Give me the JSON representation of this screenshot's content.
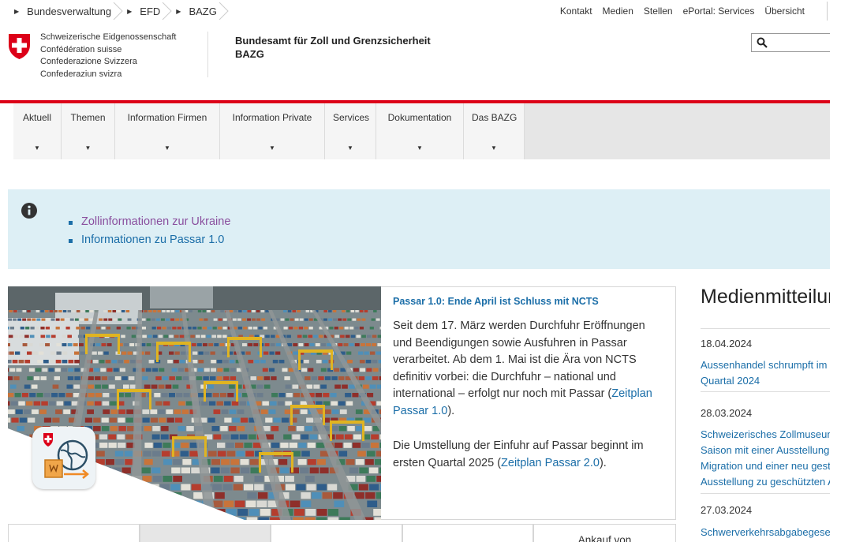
{
  "breadcrumb": [
    "Bundesverwaltung",
    "EFD",
    "BAZG"
  ],
  "toplinks": [
    "Kontakt",
    "Medien",
    "Stellen",
    "ePortal: Services",
    "Übersicht"
  ],
  "confederation": [
    "Schweizerische Eidgenossenschaft",
    "Confédération suisse",
    "Confederazione Svizzera",
    "Confederaziun svizra"
  ],
  "office": {
    "line1": "Bundesamt für Zoll und Grenzsicherheit",
    "line2": "BAZG"
  },
  "search": {
    "placeholder": ""
  },
  "nav": [
    "Aktuell",
    "Themen",
    "Information Firmen",
    "Information Private",
    "Services",
    "Dokumentation",
    "Das BAZG"
  ],
  "info": {
    "items": [
      "Zollinformationen zur Ukraine",
      "Informationen zu Passar 1.0"
    ]
  },
  "teaser": {
    "title": "Passar 1.0: Ende April ist Schluss mit NCTS",
    "p1_text": "Seit dem 17. März werden Durchfuhr Eröffnungen und Beendigungen sowie Ausfuhren in Passar verarbeitet. Ab dem 1. Mai ist die Ära von NCTS definitiv vorbei: die Durchfuhr – national und international – erfolgt nur noch mit Passar (",
    "p1_link": "Zeitplan Passar 1.0",
    "p1_end": ").",
    "p2_text": "Die Umstellung der Einfuhr auf Passar beginnt im ersten Quartal 2025 (",
    "p2_link": "Zeitplan Passar 2.0",
    "p2_end": ")."
  },
  "tabs": [
    "",
    "",
    "",
    "",
    "Ankauf von"
  ],
  "media": {
    "heading": "Medienmitteilungen",
    "items": [
      {
        "date": "18.04.2024",
        "lines": [
          "Aussenhandel schrumpft im ersten",
          "Quartal 2024"
        ]
      },
      {
        "date": "28.03.2024",
        "lines": [
          "Schweizerisches Zollmuseum: Neue",
          "Saison mit einer Ausstellung zu",
          "Migration und einer neu gestalteten",
          "Ausstellung zu geschützten Arten"
        ]
      },
      {
        "date": "27.03.2024",
        "lines": [
          "Schwerverkehrsabgabegesetz"
        ]
      }
    ]
  },
  "colors": {
    "accent_red": "#dc0018",
    "link_blue": "#1b6ea8",
    "info_bg": "#ddeff5",
    "visited": "#8a4f9e"
  }
}
